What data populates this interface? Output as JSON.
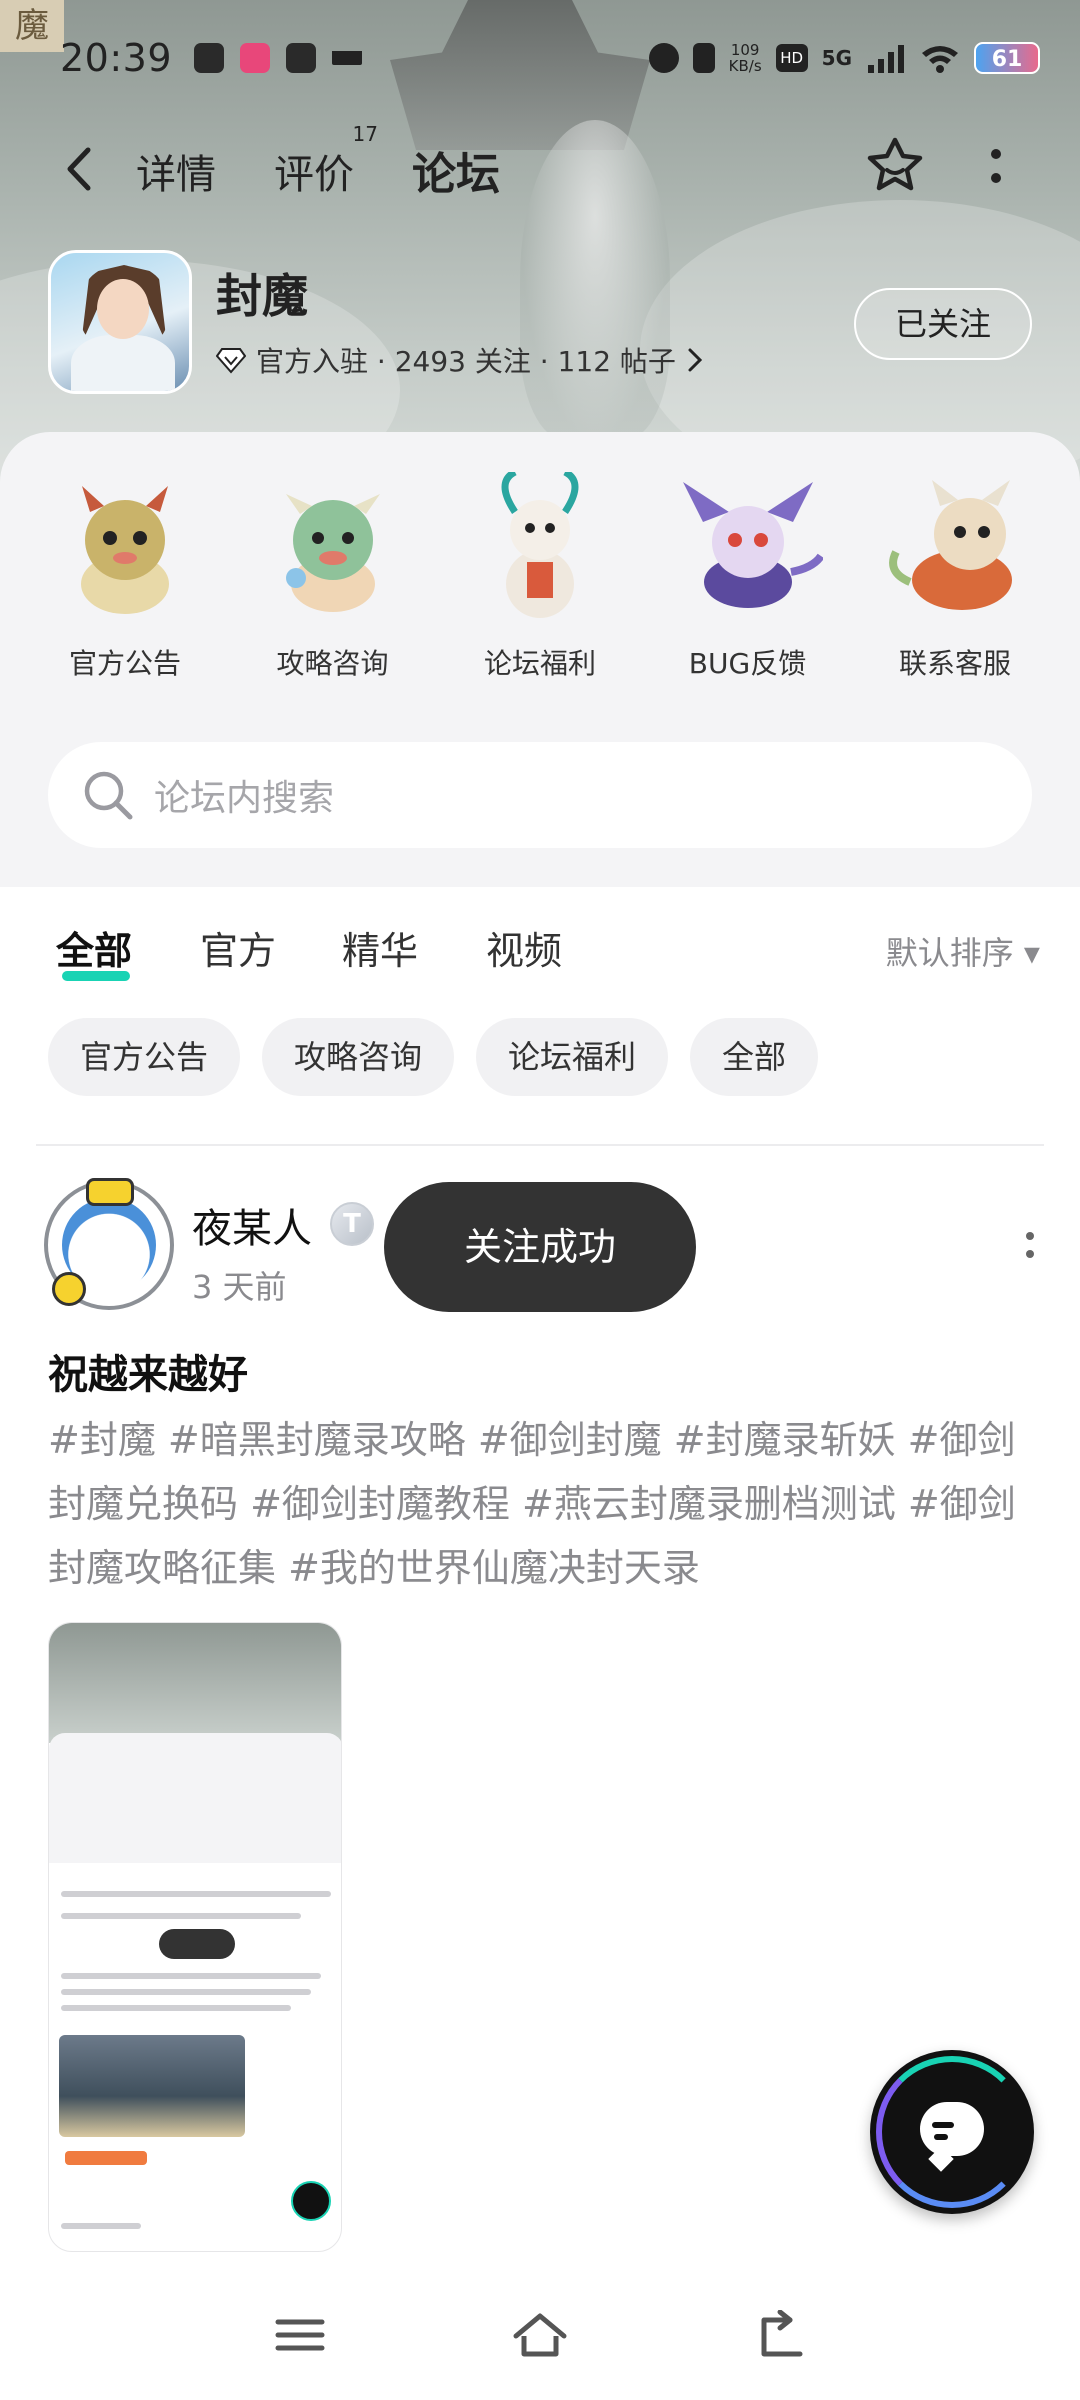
{
  "status_bar": {
    "time": "20:39",
    "net_speed_value": "109",
    "net_speed_unit": "KB/s",
    "hd": "HD",
    "signal": "5G",
    "battery": "61"
  },
  "hero": {
    "seal_char": "魔"
  },
  "nav": {
    "tabs": [
      {
        "label": "详情"
      },
      {
        "label": "评价",
        "count": "17"
      },
      {
        "label": "论坛"
      }
    ],
    "active_tab": "论坛"
  },
  "game": {
    "name": "封魔",
    "meta": "官方入驻 · 2493 关注 · 112 帖子",
    "follow_label": "已关注"
  },
  "categories": [
    {
      "label": "官方公告",
      "color": "#c9b36a"
    },
    {
      "label": "攻略咨询",
      "color": "#8fc29a"
    },
    {
      "label": "论坛福利",
      "color": "#e6e2dc"
    },
    {
      "label": "BUG反馈",
      "color": "#7e6bc4"
    },
    {
      "label": "联系客服",
      "color": "#d9b891"
    }
  ],
  "search": {
    "placeholder": "论坛内搜索"
  },
  "filter_tabs": [
    "全部",
    "官方",
    "精华",
    "视频"
  ],
  "sort_label": "默认排序 ▾",
  "chips": [
    "官方公告",
    "攻略咨询",
    "论坛福利",
    "全部"
  ],
  "post": {
    "author": "夜某人",
    "level": "T",
    "time": "3 天前",
    "toast": "关注成功",
    "title": "祝越来越好",
    "tags": "#封魔 #暗黑封魔录攻略 #御剑封魔 #封魔录斩妖 #御剑封魔兑换码 #御剑封魔教程 #燕云封魔录删档测试 #御剑封魔攻略征集 #我的世界仙魔决封天录"
  },
  "colors": {
    "accent": "#19d3b4",
    "toast_bg": "#333333",
    "chip_bg": "#f1f1f3"
  }
}
